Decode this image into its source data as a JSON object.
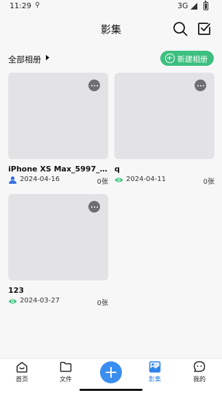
{
  "status_bar": {
    "time": "11:29",
    "network": "3G"
  },
  "header": {
    "title": "影集"
  },
  "filter": {
    "label": "全部相册",
    "new_album_label": "新建相册"
  },
  "albums": [
    {
      "name": "iPhone XS Max_5997_pic...",
      "date": "2024-04-16",
      "count": "0张",
      "meta_icon": "person-icon"
    },
    {
      "name": "q",
      "date": "2024-04-11",
      "count": "0张",
      "meta_icon": "eye-icon"
    },
    {
      "name": "123",
      "date": "2024-03-27",
      "count": "0张",
      "meta_icon": "eye-icon"
    }
  ],
  "tabs": {
    "home": "首页",
    "files": "文件",
    "albums": "影集",
    "me": "我的",
    "active": "albums"
  },
  "colors": {
    "accent_green": "#3dbf7f",
    "accent_blue": "#2f86e8",
    "placeholder_gray": "#e3e3e6"
  }
}
